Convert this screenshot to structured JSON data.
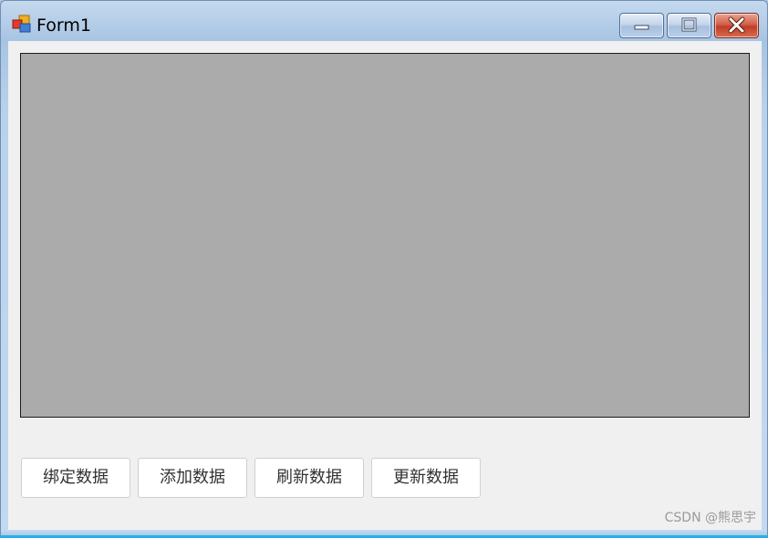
{
  "window": {
    "title": "Form1",
    "icon": "winforms-app-icon",
    "caption_buttons": [
      "minimize-icon",
      "maximize-icon",
      "close-icon"
    ]
  },
  "main": {
    "data_grid": {
      "background_color": "#ababab"
    },
    "buttons": [
      {
        "label": "绑定数据"
      },
      {
        "label": "添加数据"
      },
      {
        "label": "刷新数据"
      },
      {
        "label": "更新数据"
      }
    ]
  },
  "watermark": "CSDN @熊思宇",
  "colors": {
    "close_button": "#c84a33",
    "client_background": "#f0f0f0",
    "taskbar_accent": "#27b0e8"
  }
}
